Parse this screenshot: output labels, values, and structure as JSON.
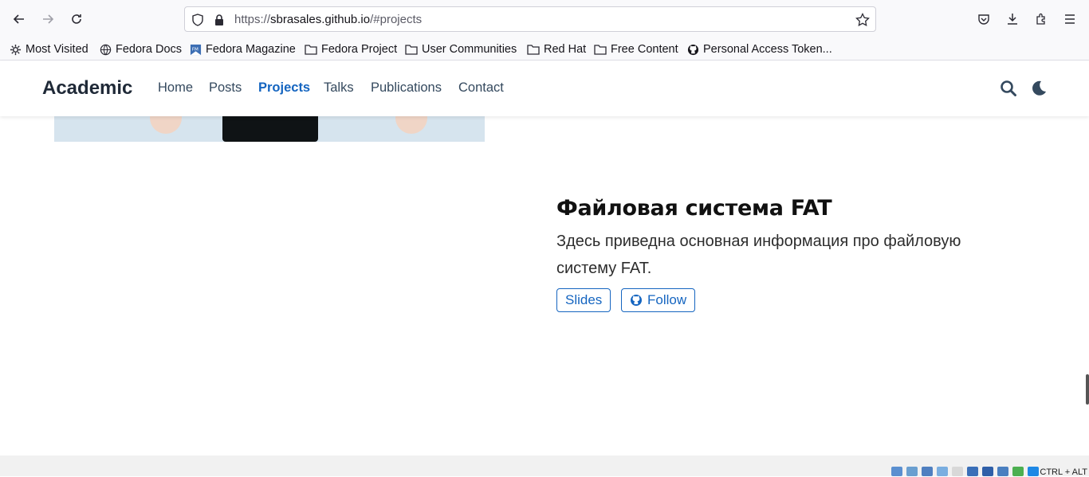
{
  "browser": {
    "url_prefix": "https://",
    "url_host": "sbrasales.github.io",
    "url_path": "/#projects"
  },
  "bookmarks": [
    {
      "label": "Most Visited",
      "icon": "gear-icon"
    },
    {
      "label": "Fedora Docs",
      "icon": "globe-icon"
    },
    {
      "label": "Fedora Magazine",
      "icon": "fedora-magazine-icon"
    },
    {
      "label": "Fedora Project",
      "icon": "folder-icon"
    },
    {
      "label": "User Communities",
      "icon": "folder-icon"
    },
    {
      "label": "Red Hat",
      "icon": "folder-icon"
    },
    {
      "label": "Free Content",
      "icon": "folder-icon"
    },
    {
      "label": "Personal Access Token...",
      "icon": "github-icon"
    }
  ],
  "site": {
    "brand": "Academic",
    "nav": [
      "Home",
      "Posts",
      "Projects",
      "Talks",
      "Publications",
      "Contact"
    ],
    "active_nav": "Projects",
    "accent_color": "#1565c0"
  },
  "project": {
    "title": "Файловая система FAT",
    "description": "Здесь приведна основная информация про файловую систему FAT.",
    "slides_label": "Slides",
    "follow_label": "Follow"
  },
  "tray": {
    "shortcut": "CTRL + ALT"
  }
}
